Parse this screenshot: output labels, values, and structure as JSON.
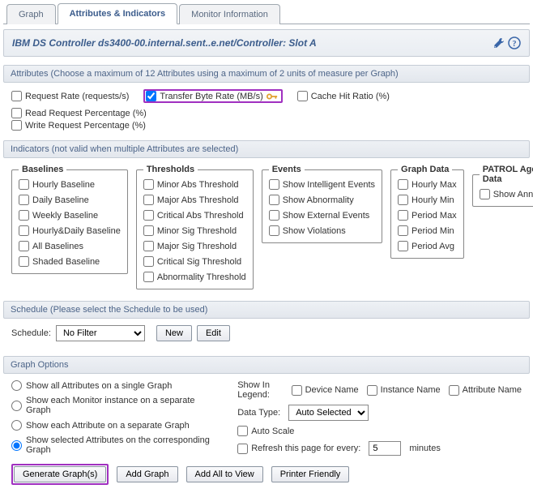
{
  "tabs": {
    "graph": "Graph",
    "attrs": "Attributes & Indicators",
    "monitor": "Monitor Information"
  },
  "title": "IBM DS Controller ds3400-00.internal.sent..e.net/Controller: Slot A",
  "sections": {
    "attributes_hdr": "Attributes (Choose a maximum of 12 Attributes using a maximum of 2 units of measure per Graph)",
    "indicators_hdr": "Indicators (not valid when multiple Attributes are selected)",
    "schedule_hdr": "Schedule (Please select the Schedule to be used)",
    "graphopts_hdr": "Graph Options"
  },
  "attributes": {
    "request_rate": "Request Rate (requests/s)",
    "transfer_rate": "Transfer Byte Rate (MB/s)",
    "cache_hit": "Cache Hit Ratio (%)",
    "read_req": "Read Request Percentage (%)",
    "write_req": "Write Request Percentage (%)"
  },
  "indicators": {
    "baselines": {
      "legend": "Baselines",
      "items": [
        "Hourly Baseline",
        "Daily Baseline",
        "Weekly Baseline",
        "Hourly&Daily Baseline",
        "All Baselines",
        "Shaded Baseline"
      ]
    },
    "thresholds": {
      "legend": "Thresholds",
      "items": [
        "Minor Abs Threshold",
        "Major Abs Threshold",
        "Critical Abs Threshold",
        "Minor Sig Threshold",
        "Major Sig Threshold",
        "Critical Sig Threshold",
        "Abnormality Threshold"
      ]
    },
    "events": {
      "legend": "Events",
      "items": [
        "Show Intelligent Events",
        "Show Abnormality",
        "Show External Events",
        "Show Violations"
      ]
    },
    "graphdata": {
      "legend": "Graph Data",
      "items": [
        "Hourly Max",
        "Hourly Min",
        "Period Max",
        "Period Min",
        "Period Avg"
      ]
    },
    "patrol": {
      "legend": "PATROL Agent Data",
      "items": [
        "Show Annotations"
      ]
    }
  },
  "schedule": {
    "label": "Schedule:",
    "selected": "No Filter",
    "new_btn": "New",
    "edit_btn": "Edit"
  },
  "graph_options": {
    "r1": "Show all Attributes on a single Graph",
    "r2": "Show each Monitor instance on a separate Graph",
    "r3": "Show each Attribute on a separate Graph",
    "r4": "Show selected Attributes on the corresponding Graph",
    "legend_label": "Show In Legend:",
    "device_name": "Device Name",
    "instance_name": "Instance Name",
    "attribute_name": "Attribute Name",
    "data_type_label": "Data Type:",
    "data_type_value": "Auto Selected",
    "auto_scale": "Auto Scale",
    "refresh_prefix": "Refresh this page for every:",
    "refresh_value": "5",
    "refresh_suffix": "minutes"
  },
  "buttons": {
    "generate": "Generate Graph(s)",
    "add_graph": "Add Graph",
    "add_all": "Add All to View",
    "printer": "Printer Friendly"
  }
}
